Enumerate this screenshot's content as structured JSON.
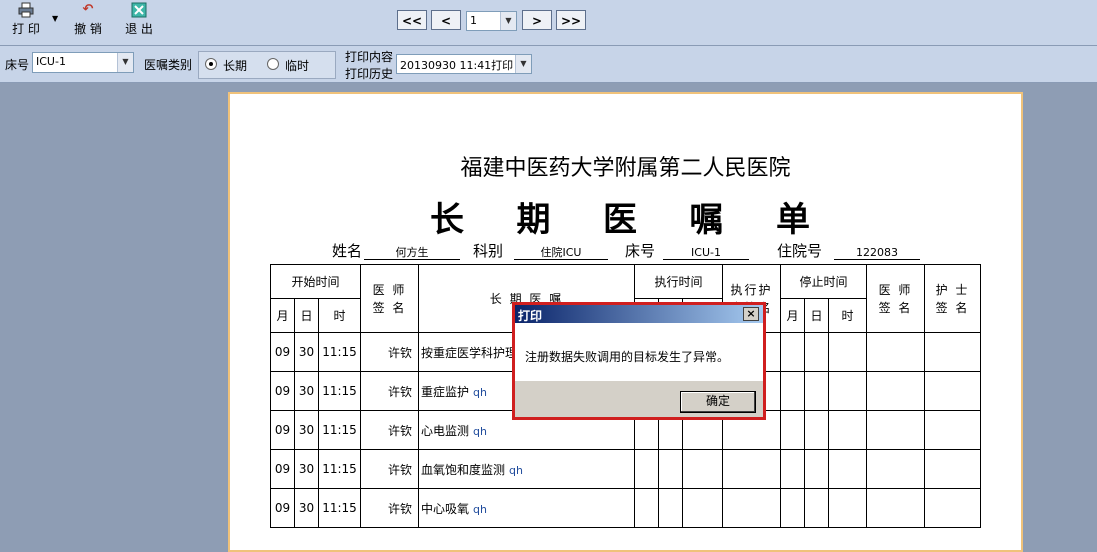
{
  "toolbar": {
    "print_label": "打 印",
    "undo_label": "撤 销",
    "exit_label": "退 出",
    "nav": {
      "first": "<<",
      "prev": "<",
      "page": "1",
      "next": ">",
      "last": ">>"
    }
  },
  "filter": {
    "bed_label": "床号",
    "bed_value": "ICU-1",
    "order_type_label": "医嘱类别",
    "long_term_label": "长期",
    "temporary_label": "临时",
    "selected": "长期",
    "print_content_label": "打印内容",
    "print_history_label": "打印历史",
    "print_history_value": "20130930  11:41打印"
  },
  "sheet": {
    "hospital": "福建中医药大学附属第二人民医院",
    "title_chars": [
      "长",
      "期",
      "医",
      "嘱",
      "单"
    ],
    "name_label": "姓名",
    "name_value": "何方生",
    "dept_label": "科别",
    "dept_value": "住院ICU",
    "bed_label": "床号",
    "bed_value": "ICU-1",
    "admission_label": "住院号",
    "admission_value": "122083",
    "headers": {
      "start_time": "开始时间",
      "month": "月",
      "day": "日",
      "time": "时",
      "doctor_sign": "医 师\n签 名",
      "order": "长 期 医 嘱",
      "exec_time": "执行时间",
      "exec_nurse": "执行护\n士签名",
      "stop_time": "停止时间",
      "doctor_sign2": "医 师\n签 名",
      "nurse_sign": "护 士\n签 名"
    },
    "rows": [
      {
        "month": "09",
        "day": "30",
        "time": "11:15",
        "doctor": "许钦",
        "order": "按重症医学科护理",
        "freq": ""
      },
      {
        "month": "09",
        "day": "30",
        "time": "11:15",
        "doctor": "许钦",
        "order": "重症监护",
        "freq": "qh"
      },
      {
        "month": "09",
        "day": "30",
        "time": "11:15",
        "doctor": "许钦",
        "order": "心电监测",
        "freq": "qh"
      },
      {
        "month": "09",
        "day": "30",
        "time": "11:15",
        "doctor": "许钦",
        "order": "血氧饱和度监测",
        "freq": "qh"
      },
      {
        "month": "09",
        "day": "30",
        "time": "11:15",
        "doctor": "许钦",
        "order": "中心吸氧",
        "freq": "qh"
      }
    ]
  },
  "dialog": {
    "title": "打印",
    "close": "×",
    "message": "注册数据失败调用的目标发生了异常。",
    "ok_label": "确定"
  }
}
